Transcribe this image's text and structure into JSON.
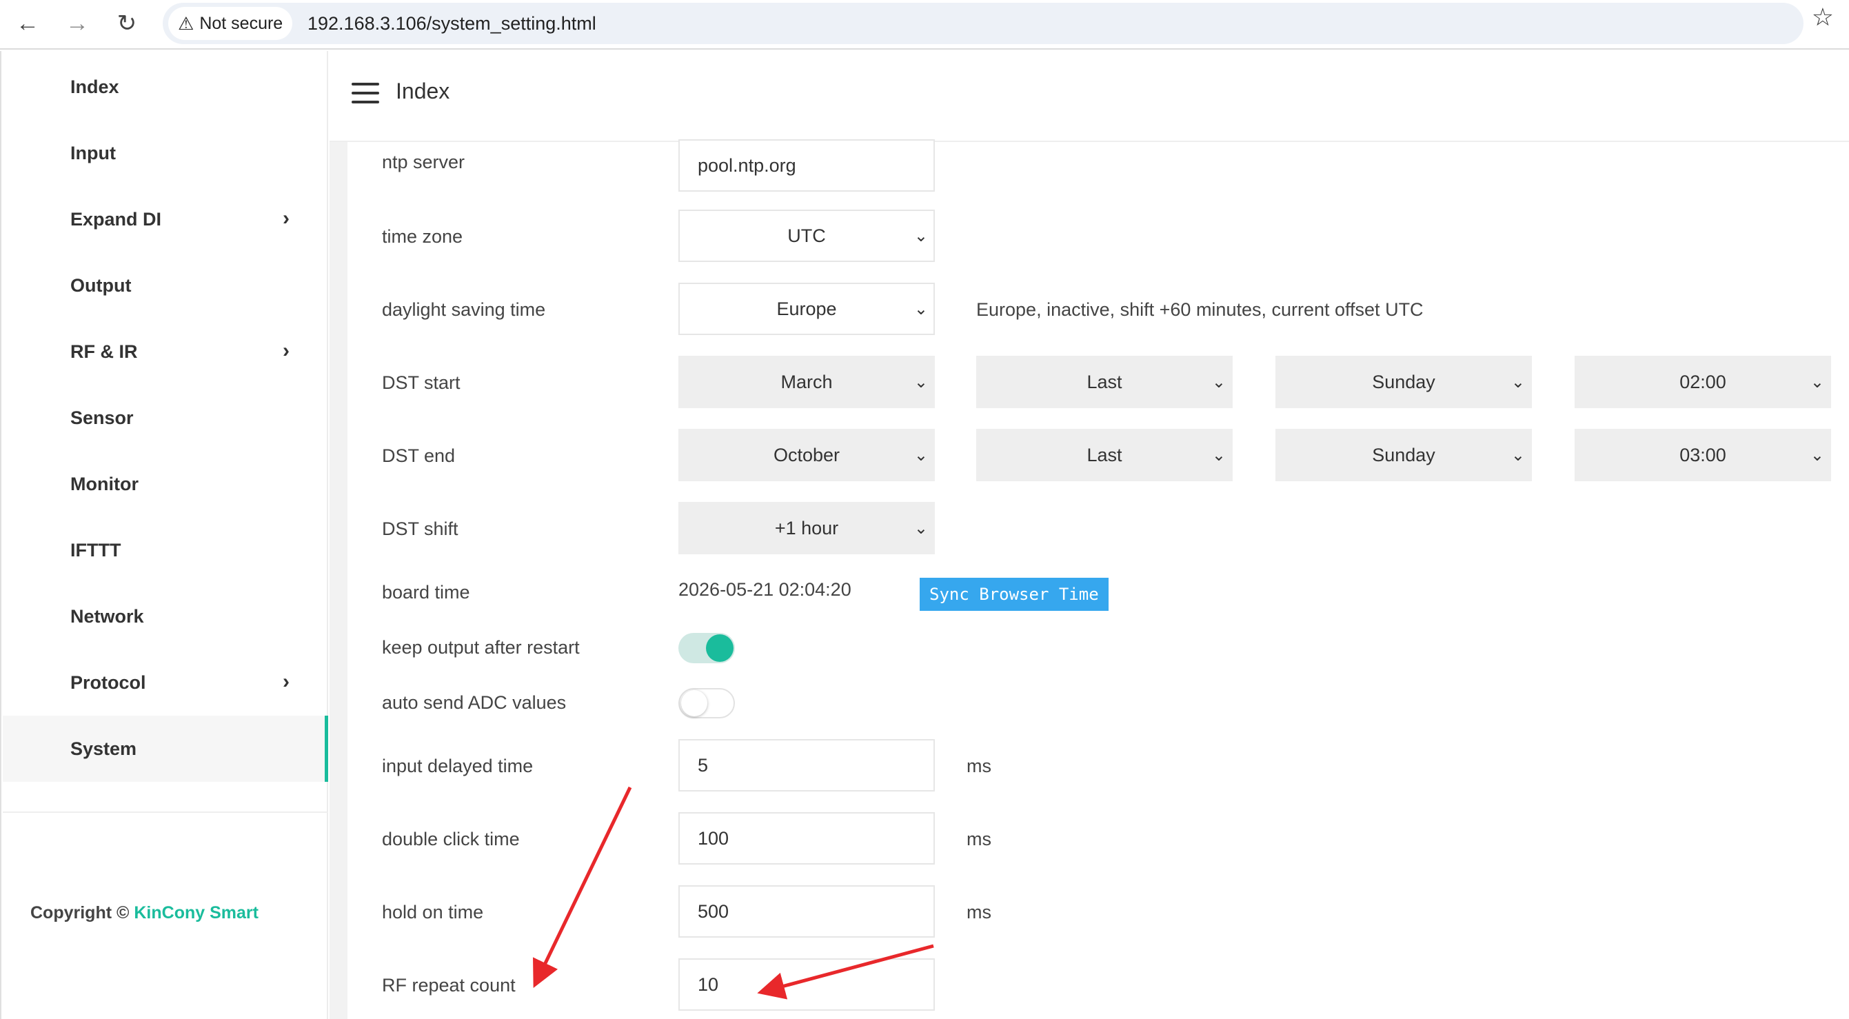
{
  "browser": {
    "back_icon": "←",
    "forward_icon": "→",
    "reload_icon": "↻",
    "security_label": "Not secure",
    "url": "192.168.3.106/system_setting.html"
  },
  "sidebar": {
    "items": [
      {
        "label": "Index",
        "has_submenu": false
      },
      {
        "label": "Input",
        "has_submenu": false
      },
      {
        "label": "Expand DI",
        "has_submenu": true
      },
      {
        "label": "Output",
        "has_submenu": false
      },
      {
        "label": "RF & IR",
        "has_submenu": true
      },
      {
        "label": "Sensor",
        "has_submenu": false
      },
      {
        "label": "Monitor",
        "has_submenu": false
      },
      {
        "label": "IFTTT",
        "has_submenu": false
      },
      {
        "label": "Network",
        "has_submenu": false
      },
      {
        "label": "Protocol",
        "has_submenu": true
      },
      {
        "label": "System",
        "has_submenu": false,
        "active": true
      }
    ],
    "copyright_prefix": "Copyright ©",
    "copyright_brand": "KinCony Smart"
  },
  "header": {
    "title": "Index"
  },
  "form": {
    "ntp_server": {
      "label": "ntp server",
      "value": "pool.ntp.org"
    },
    "time_zone": {
      "label": "time zone",
      "value": "UTC"
    },
    "dst": {
      "label": "daylight saving time",
      "value": "Europe",
      "status": "Europe, inactive, shift +60 minutes, current offset UTC"
    },
    "dst_start": {
      "label": "DST start",
      "month": "March",
      "week": "Last",
      "day": "Sunday",
      "time": "02:00"
    },
    "dst_end": {
      "label": "DST end",
      "month": "October",
      "week": "Last",
      "day": "Sunday",
      "time": "03:00"
    },
    "dst_shift": {
      "label": "DST shift",
      "value": "+1 hour"
    },
    "board_time": {
      "label": "board time",
      "value": "2026-05-21 02:04:20",
      "button": "Sync Browser Time"
    },
    "keep_output": {
      "label": "keep output after restart",
      "enabled": true
    },
    "auto_send_adc": {
      "label": "auto send ADC values",
      "enabled": false
    },
    "input_delayed": {
      "label": "input delayed time",
      "value": "5",
      "unit": "ms"
    },
    "double_click": {
      "label": "double click time",
      "value": "100",
      "unit": "ms"
    },
    "hold_on": {
      "label": "hold on time",
      "value": "500",
      "unit": "ms"
    },
    "rf_repeat": {
      "label": "RF repeat count",
      "value": "10"
    }
  },
  "colors": {
    "accent": "#1abc9c",
    "button": "#36a7ee",
    "annotation_arrow": "#e8282b"
  }
}
